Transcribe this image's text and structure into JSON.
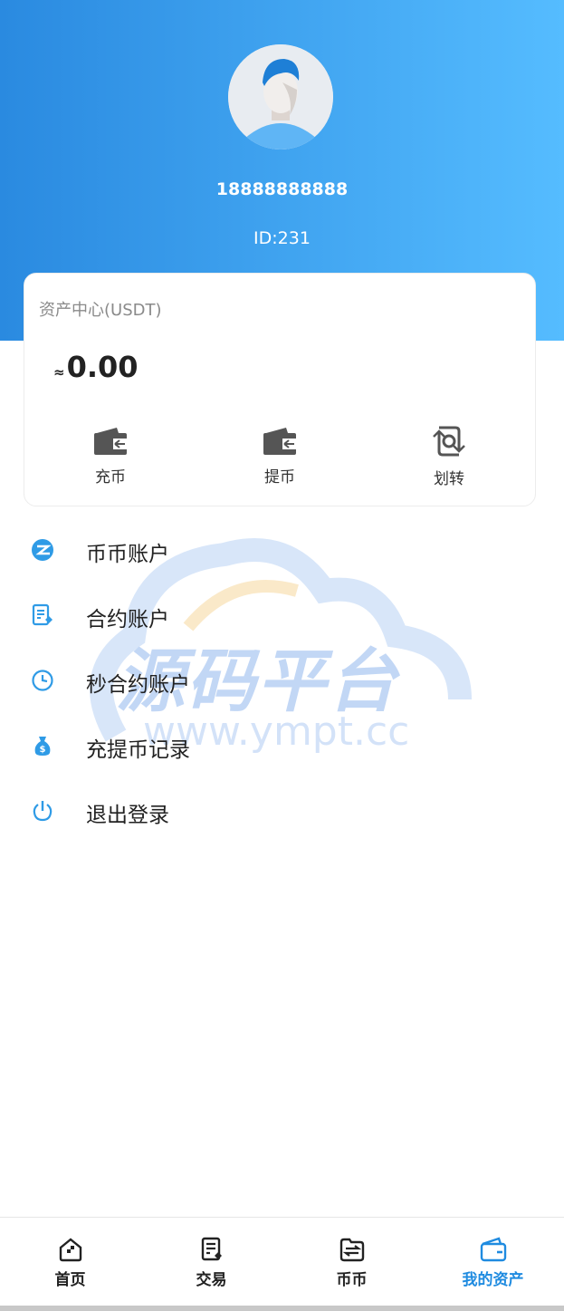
{
  "profile": {
    "phone": "18888888888",
    "id_text": "ID:231"
  },
  "assets": {
    "title": "资产中心(USDT)",
    "approx": "≈",
    "balance": "0.00",
    "actions": [
      {
        "label": "充币",
        "icon": "wallet-icon"
      },
      {
        "label": "提币",
        "icon": "wallet-icon"
      },
      {
        "label": "划转",
        "icon": "transfer-icon"
      }
    ]
  },
  "menu": [
    {
      "label": "币币账户",
      "icon": "coin-account-icon"
    },
    {
      "label": "合约账户",
      "icon": "contract-document-icon"
    },
    {
      "label": "秒合约账户",
      "icon": "clock-icon"
    },
    {
      "label": "充提币记录",
      "icon": "money-bag-icon"
    },
    {
      "label": "退出登录",
      "icon": "power-icon"
    }
  ],
  "watermark": {
    "title": "源码平台",
    "url": "www.ympt.cc"
  },
  "tabbar": [
    {
      "label": "首页",
      "icon": "home-icon",
      "active": false
    },
    {
      "label": "交易",
      "icon": "trade-icon",
      "active": false
    },
    {
      "label": "币币",
      "icon": "exchange-folder-icon",
      "active": false
    },
    {
      "label": "我的资产",
      "icon": "wallet-icon",
      "active": true
    }
  ],
  "colors": {
    "accent": "#1f8be0",
    "gradient_start": "#2a8ae0",
    "gradient_end": "#55bcff",
    "icon_blue": "#2f9be6"
  }
}
